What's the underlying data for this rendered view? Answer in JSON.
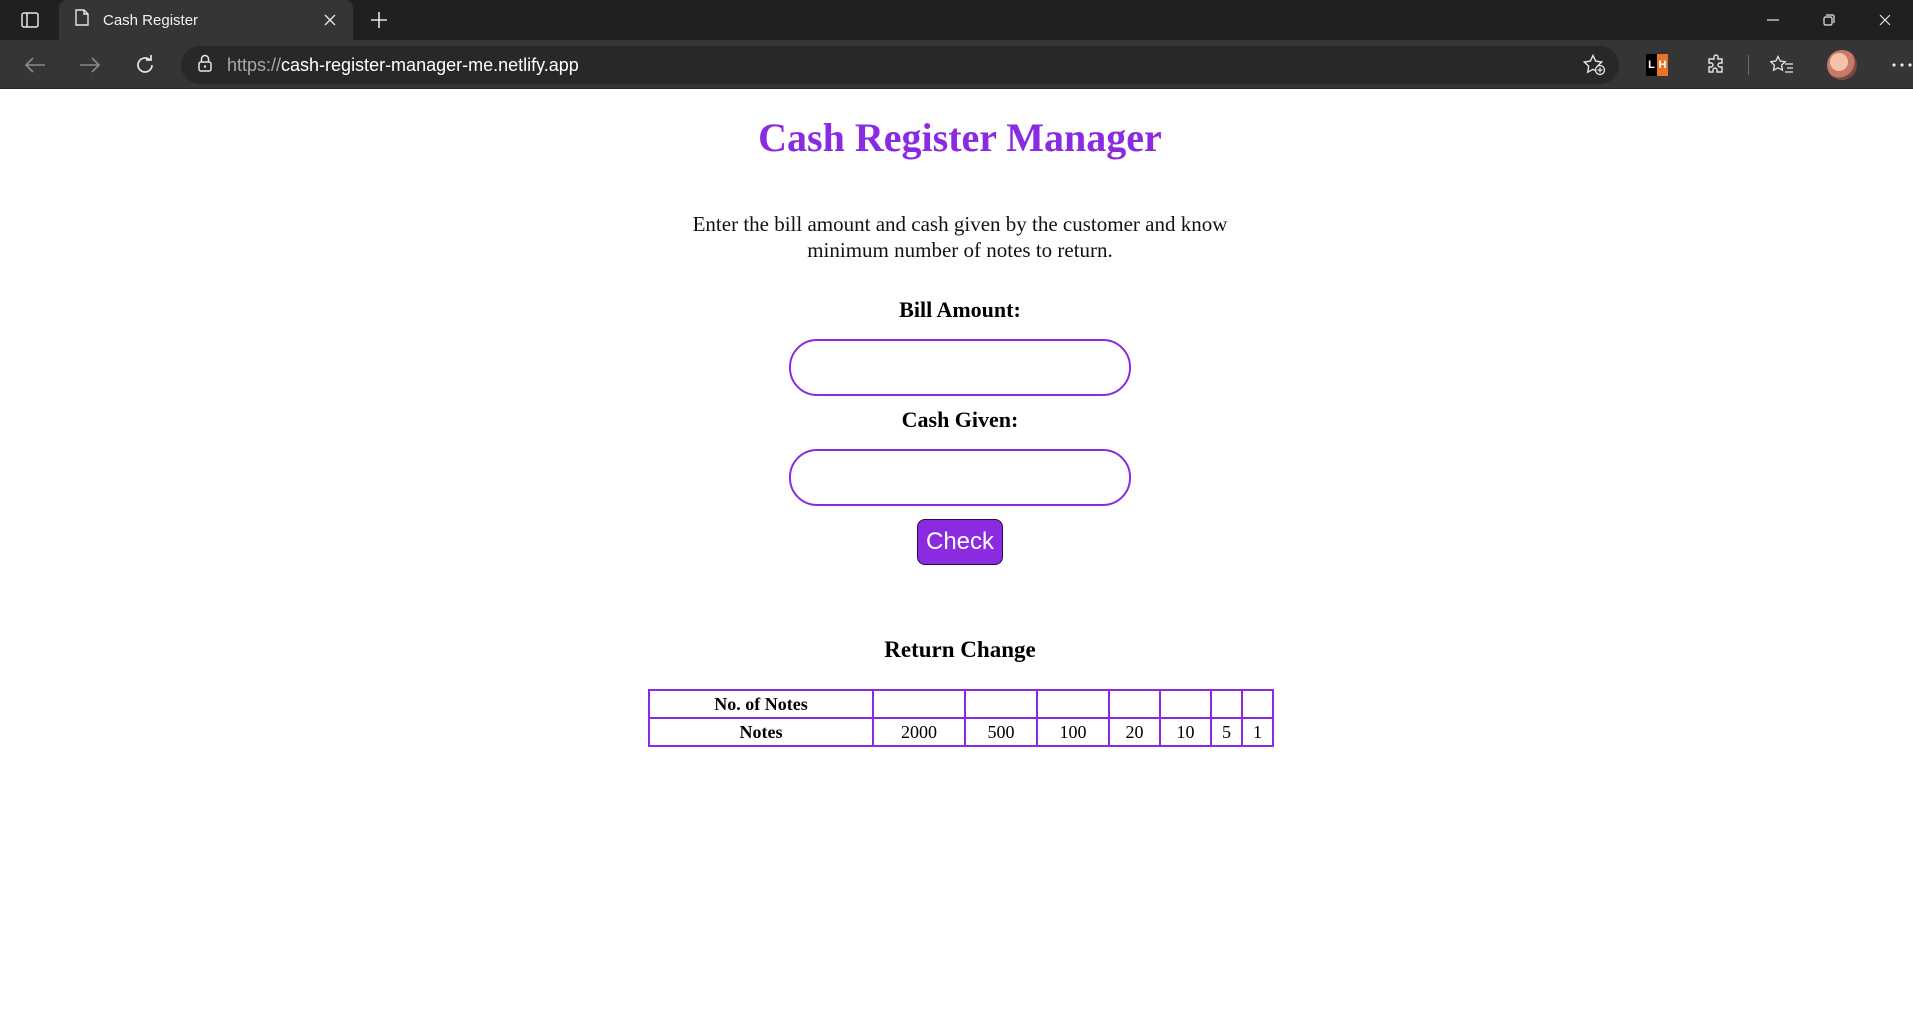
{
  "browser": {
    "tab_title": "Cash Register",
    "url_scheme": "https://",
    "url_host": "cash-register-manager-me.netlify.app",
    "extension_badge": {
      "left": "L",
      "right": "H"
    }
  },
  "page": {
    "title": "Cash Register Manager",
    "description": "Enter the bill amount and cash given by the customer and know minimum number of notes to return.",
    "bill_label": "Bill Amount:",
    "bill_value": "",
    "cash_label": "Cash Given:",
    "cash_value": "",
    "check_label": "Check",
    "return_heading": "Return Change",
    "table": {
      "row1_header": "No. of Notes",
      "row2_header": "Notes",
      "counts": [
        "",
        "",
        "",
        "",
        "",
        "",
        ""
      ],
      "notes": [
        "2000",
        "500",
        "100",
        "20",
        "10",
        "5",
        "1"
      ]
    }
  },
  "colors": {
    "accent": "#8a2be2",
    "chrome_dark": "#202020",
    "chrome_toolbar": "#353535"
  }
}
